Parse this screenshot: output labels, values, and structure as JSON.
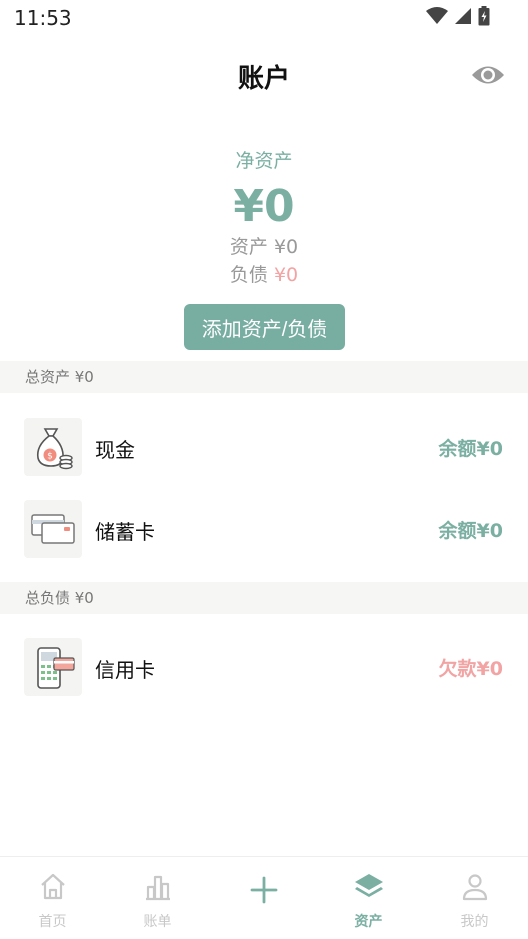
{
  "status": {
    "time": "11:53"
  },
  "header": {
    "title": "账户"
  },
  "summary": {
    "net_label": "净资产",
    "net_value": "¥0",
    "assets_label": "资产",
    "assets_value": "¥0",
    "debts_label": "负债",
    "debts_value": "¥0"
  },
  "add_button": {
    "label": "添加资产/负债"
  },
  "assets_section": {
    "header": "总资产 ¥0",
    "items": [
      {
        "name": "现金",
        "amount": "余额¥0"
      },
      {
        "name": "储蓄卡",
        "amount": "余额¥0"
      }
    ]
  },
  "debts_section": {
    "header": "总负债 ¥0",
    "items": [
      {
        "name": "信用卡",
        "amount": "欠款¥0"
      }
    ]
  },
  "tabbar": {
    "tabs": [
      {
        "label": "首页",
        "icon": "home-icon"
      },
      {
        "label": "账单",
        "icon": "bar-chart-icon"
      },
      {
        "label": "",
        "icon": "plus-icon"
      },
      {
        "label": "资产",
        "icon": "layers-icon"
      },
      {
        "label": "我的",
        "icon": "user-icon"
      }
    ],
    "active": "资产"
  },
  "colors": {
    "accent": "#78ada1",
    "accent_text": "#7aafa2",
    "debt": "#f2a3a3",
    "section_bg": "#f6f6f4"
  }
}
